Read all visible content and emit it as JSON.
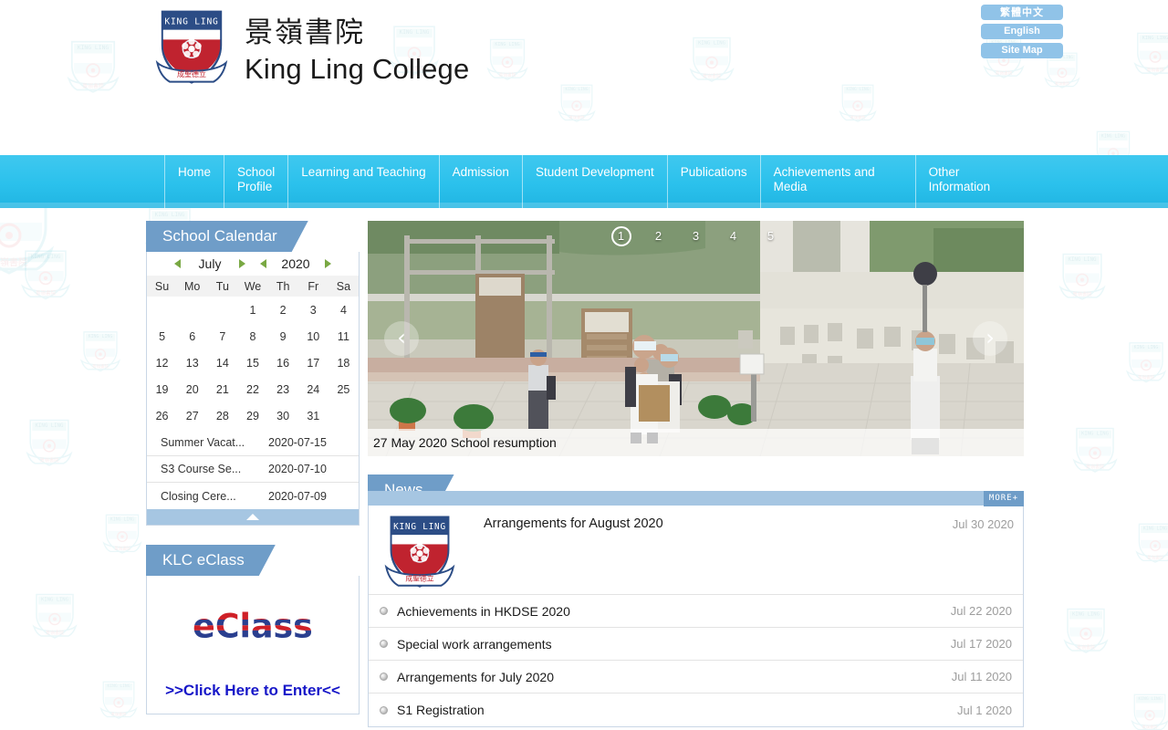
{
  "header": {
    "school_name_cn": "景嶺書院",
    "school_name_en": "King Ling College",
    "crest_icon": "school-crest-icon",
    "buttons": [
      {
        "label": "繁體中文",
        "name": "lang-traditional-chinese"
      },
      {
        "label": "English",
        "name": "lang-english"
      },
      {
        "label": "Site Map",
        "name": "site-map"
      }
    ]
  },
  "nav": {
    "items": [
      {
        "label": "Home"
      },
      {
        "label": "School\nProfile"
      },
      {
        "label": "Learning and Teaching"
      },
      {
        "label": "Admission"
      },
      {
        "label": "Student Development"
      },
      {
        "label": "Publications"
      },
      {
        "label": "Achievements and Media"
      },
      {
        "label": "Other\nInformation"
      }
    ]
  },
  "calendar": {
    "panel_title": "School Calendar",
    "month": "July",
    "year": "2020",
    "prev_month_icon": "caret-left-icon",
    "next_month_icon": "caret-right-icon",
    "prev_year_icon": "caret-left-icon",
    "next_year_icon": "caret-right-icon",
    "weekdays": [
      "Su",
      "Mo",
      "Tu",
      "We",
      "Th",
      "Fr",
      "Sa"
    ],
    "today": 30,
    "weeks": [
      [
        {
          "d": "",
          "c": "blank"
        },
        {
          "d": "",
          "c": "blank"
        },
        {
          "d": "",
          "c": "blank"
        },
        {
          "d": "1",
          "c": "green"
        },
        {
          "d": "2",
          "c": "green"
        },
        {
          "d": "3",
          "c": "green"
        },
        {
          "d": "4",
          "c": "green"
        }
      ],
      [
        {
          "d": "5",
          "c": "green"
        },
        {
          "d": "6",
          "c": "green"
        },
        {
          "d": "7",
          "c": "green"
        },
        {
          "d": "8",
          "c": "green"
        },
        {
          "d": "9",
          "c": "green"
        },
        {
          "d": "10",
          "c": "green"
        },
        {
          "d": "11",
          "c": "green"
        }
      ],
      [
        {
          "d": "12",
          "c": "green"
        },
        {
          "d": "13",
          "c": "green"
        },
        {
          "d": "14",
          "c": "green"
        },
        {
          "d": "15",
          "c": "pink"
        },
        {
          "d": "16",
          "c": "pink"
        },
        {
          "d": "17",
          "c": "pink"
        },
        {
          "d": "18",
          "c": "pink"
        }
      ],
      [
        {
          "d": "19",
          "c": "pink"
        },
        {
          "d": "20",
          "c": "pink"
        },
        {
          "d": "21",
          "c": "pink"
        },
        {
          "d": "22",
          "c": "pink"
        },
        {
          "d": "23",
          "c": "pink"
        },
        {
          "d": "24",
          "c": "pink"
        },
        {
          "d": "25",
          "c": "pink"
        }
      ],
      [
        {
          "d": "26",
          "c": "pink"
        },
        {
          "d": "27",
          "c": "pink"
        },
        {
          "d": "28",
          "c": "pink"
        },
        {
          "d": "29",
          "c": "pink"
        },
        {
          "d": "30",
          "c": "today"
        },
        {
          "d": "31",
          "c": "pink"
        },
        {
          "d": "",
          "c": "blank"
        }
      ]
    ],
    "events": [
      {
        "title": "Summer Vacat...",
        "date": "2020-07-15"
      },
      {
        "title": "S3 Course Se...",
        "date": "2020-07-10"
      },
      {
        "title": "Closing Cere...",
        "date": "2020-07-09"
      }
    ],
    "collapse_icon": "triangle-up-icon"
  },
  "eclass": {
    "panel_title": "KLC eClass",
    "logo_text": "eClass",
    "logo_icon": "eclass-logo",
    "link_label": ">>Click Here to Enter<<"
  },
  "carousel": {
    "caption": "27 May 2020 School resumption",
    "slides": [
      "1",
      "2",
      "3",
      "4",
      "5"
    ],
    "active_slide": "1",
    "prev_icon": "chevron-left-icon",
    "next_icon": "chevron-right-icon",
    "prev_label": "‹",
    "next_label": "›"
  },
  "news": {
    "panel_title": "News",
    "more_label": "MORE+",
    "featured": {
      "title": "Arrangements for August 2020",
      "date": "Jul 30 2020",
      "thumb_icon": "school-crest-icon"
    },
    "items": [
      {
        "title": "Achievements in HKDSE 2020",
        "date": "Jul 22 2020"
      },
      {
        "title": "Special work arrangements",
        "date": "Jul 17 2020"
      },
      {
        "title": "Arrangements for July 2020",
        "date": "Jul 11 2020"
      },
      {
        "title": "S1 Registration",
        "date": "Jul 1 2020"
      }
    ]
  },
  "colors": {
    "nav_blue": "#2bc1ec",
    "panel_blue": "#6f9dc8",
    "panel_blue_light": "#a6c6e2",
    "top_button": "#90c3e8",
    "calendar_green": "#c8f08a",
    "calendar_pink": "#ffa0c8",
    "link_blue": "#1717c8",
    "date_gray": "#9d9d9d"
  }
}
